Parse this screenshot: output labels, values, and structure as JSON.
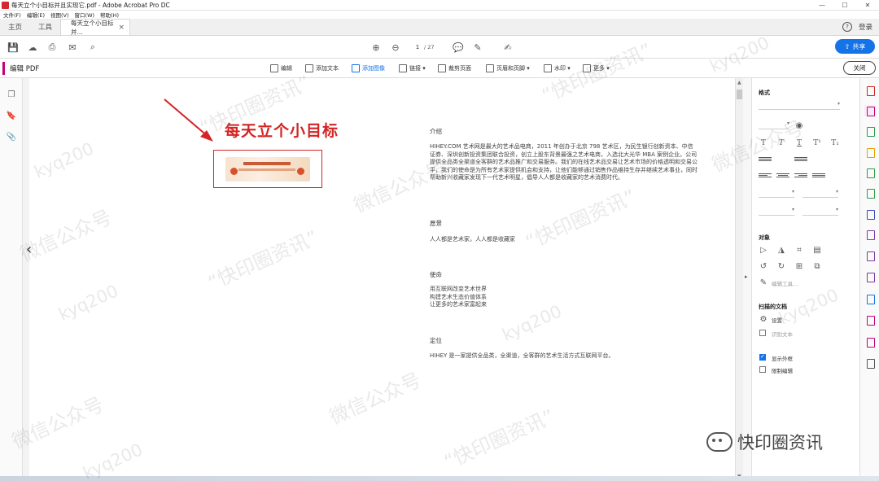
{
  "window": {
    "title": "每天立个小目标并且实现它.pdf - Adobe Acrobat Pro DC",
    "minimize": "—",
    "maximize": "☐",
    "close": "✕"
  },
  "menu": [
    "文件(F)",
    "编辑(E)",
    "视图(V)",
    "窗口(W)",
    "帮助(H)"
  ],
  "tabs": {
    "home": "主页",
    "tools": "工具",
    "doc": "每天立个小目标并...",
    "doc_close": "×",
    "help": "?",
    "login": "登录"
  },
  "toolbar": {
    "page_current": "1",
    "page_total": "/ 27",
    "share_label": "共享",
    "share_icon": "⇧"
  },
  "editbar": {
    "label": "编辑 PDF",
    "tools": [
      "编辑",
      "添加文本",
      "添加图像",
      "链接 ▾",
      "裁剪页面",
      "页眉和页脚 ▾",
      "水印 ▾",
      "更多 ▾"
    ],
    "active": "添加图像",
    "close_label": "关闭"
  },
  "document": {
    "heading": "每天立个小目标",
    "sections": [
      {
        "title": "介绍",
        "body": "HIHEY.COM 艺术网是最大的艺术品电商，2011 年创办于北京 798 艺术区，为民生银行创新资本、中信证券、深圳创新投资集团联合投资，创立上股东背景最强之艺术电商，入选北大光华 MBA 案例企业。公司提供全品类全渠道全客群的艺术品推广和交易服务。我们的在线艺术品交易让艺术市场的价格透明和交易公平，我们的使命是为所有艺术家提供机会和支持，让他们能够通过销售作品维持生存并继续艺术事业，同时帮助新兴收藏家发现下一代艺术明星，倡导人人都是收藏家的艺术消费时代。"
      },
      {
        "title": "愿景",
        "body": "人人都是艺术家，人人都是收藏家"
      },
      {
        "title": "使命",
        "body": "用互联网改变艺术世界\n构建艺术生态价值体系\n让更多的艺术家富起来"
      },
      {
        "title": "定位",
        "body": "HIHEY 是一家提供全品类，全渠道，全客群的艺术生活方式互联网平台。"
      }
    ]
  },
  "right_panel": {
    "format_title": "格式",
    "objects_title": "对象",
    "edit_tool": "编辑工具...",
    "scan_title": "扫描的文档",
    "settings": "设置",
    "recognize": "识别文本",
    "show_outline": "显示外框",
    "restrict_edit": "限制编辑",
    "show_outline_checked": true,
    "restrict_edit_checked": false,
    "recognize_checked": false
  },
  "watermark": {
    "brand_text": "快印圈资讯",
    "wm_text_1": "“快印圈资讯”",
    "wm_text_2": "微信公众号",
    "wm_text_3": "kyq200"
  },
  "colors": {
    "accent": "#1473e6",
    "edit_accent": "#c2007a",
    "heading_red": "#d42424"
  }
}
